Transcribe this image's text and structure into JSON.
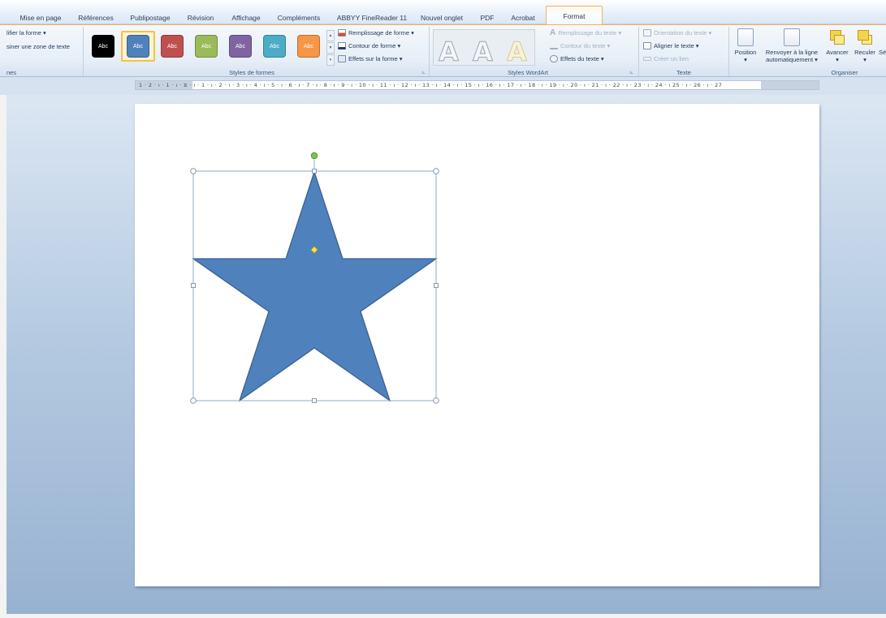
{
  "tabs": [
    {
      "label": "Mise en page",
      "active": false
    },
    {
      "label": "Références",
      "active": false
    },
    {
      "label": "Publipostage",
      "active": false
    },
    {
      "label": "Révision",
      "active": false
    },
    {
      "label": "Affichage",
      "active": false
    },
    {
      "label": "Compléments",
      "active": false
    },
    {
      "label": "ABBYY FineReader 11",
      "active": false
    },
    {
      "label": "Nouvel onglet",
      "active": false
    },
    {
      "label": "PDF",
      "active": false
    },
    {
      "label": "Acrobat",
      "active": false
    },
    {
      "label": "Format",
      "active": true
    }
  ],
  "ribbon": {
    "insert_shapes": {
      "modify_shape": "lifier la forme ▾",
      "draw_textbox": "siner une zone de texte",
      "group_label": "nes"
    },
    "shape_styles": {
      "group_label": "Styles de formes",
      "swatch_label": "Abc",
      "swatches": [
        {
          "color": "#000000",
          "selected": false
        },
        {
          "color": "#4f81bd",
          "selected": true
        },
        {
          "color": "#c0504d",
          "selected": false
        },
        {
          "color": "#9bbb59",
          "selected": false
        },
        {
          "color": "#8064a2",
          "selected": false
        },
        {
          "color": "#4bacc6",
          "selected": false
        },
        {
          "color": "#f79646",
          "selected": false
        }
      ],
      "fill": "Remplissage de forme ▾",
      "outline": "Contour de forme ▾",
      "effects": "Effets sur la forme ▾"
    },
    "wordart": {
      "group_label": "Styles WordArt",
      "letter": "A",
      "text_fill": "Remplissage du texte ▾",
      "text_outline": "Contour du texte ▾",
      "text_effects": "Effets du texte ▾"
    },
    "text": {
      "group_label": "Texte",
      "orientation": "Orientation du texte ▾",
      "align": "Aligner le texte ▾",
      "create_link": "Créer un lien"
    },
    "arrange": {
      "group_label": "Organiser",
      "position": "Position",
      "wrap_line1": "Renvoyer à la ligne",
      "wrap_line2": "automatiquement ▾",
      "forward": "Avancer",
      "backward": "Reculer",
      "select_partial": "Sé"
    }
  },
  "ruler": {
    "text": "1 · 2 · ı · 1 · ı · ⧖ · ı · 1 · ı · 2 · ı · 3 · ı · 4 · ı · 5 · ı · 6 · ı · 7 · ı · 8 · ı · 9 · ı · 10 · ı · 11 · ı · 12 · ı · 13 · ı · 14 · ı · 15 · ı · 16 · ı · 17 · ı · 18 · ı · 19 · ı · 20 · ı · 21 · ı · 22 · ı · 23 · ı · 24 · ı 25 · ı · 26 · ı · 27"
  },
  "shape": {
    "type": "five-point-star",
    "fill": "#4f81bd",
    "outline": "#3a6291",
    "selected": true
  },
  "colors": {
    "accent": "#f3b05a",
    "ribbon_text": "#1e395b",
    "workspace": "#97b2d1"
  }
}
